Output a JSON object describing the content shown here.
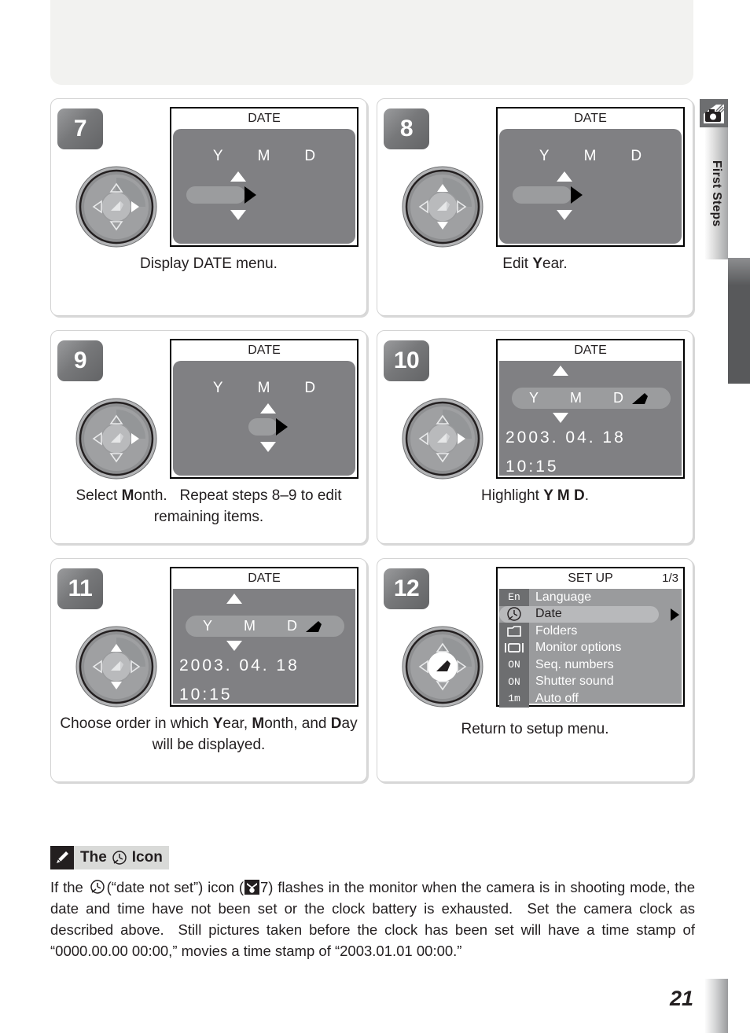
{
  "sidebar": {
    "icon_name": "hand-camera-icon",
    "tab_label": "First Steps"
  },
  "page_number": "21",
  "steps": [
    {
      "number": "7",
      "caption_html": "Display DATE menu.",
      "dial": {
        "highlight": "right"
      },
      "screen": {
        "kind": "ymd-slider",
        "title": "DATE",
        "labels": [
          "Y",
          "M",
          "D"
        ],
        "slider_column": "Y"
      }
    },
    {
      "number": "8",
      "caption_html": "Edit <b>Y</b>ear.",
      "dial": {
        "highlight": "up-down"
      },
      "screen": {
        "kind": "ymd-slider",
        "title": "DATE",
        "labels": [
          "Y",
          "M",
          "D"
        ],
        "slider_column": "Y"
      }
    },
    {
      "number": "9",
      "caption_html": "Select <b>M</b>onth.&nbsp;&nbsp; Repeat steps 8&#8211;9 to edit remaining items.",
      "dial": {
        "highlight": "right"
      },
      "screen": {
        "kind": "ymd-slider",
        "title": "DATE",
        "labels": [
          "Y",
          "M",
          "D"
        ],
        "slider_column": "M"
      }
    },
    {
      "number": "10",
      "caption_html": "Highlight <b>Y M D</b>.",
      "dial": {
        "highlight": "right"
      },
      "screen": {
        "kind": "ymd-bar",
        "title": "DATE",
        "labels": [
          "Y",
          "M",
          "D"
        ],
        "date_value": "2003. 04. 18",
        "time_value": "10:15",
        "enter_glyph": "enter-arrow-icon"
      }
    },
    {
      "number": "11",
      "caption_html": "Choose order in which <b>Y</b>ear, <b>M</b>onth, and <b>D</b>ay will be displayed.",
      "dial": {
        "highlight": "up-down"
      },
      "screen": {
        "kind": "ymd-bar",
        "title": "DATE",
        "labels": [
          "Y",
          "M",
          "D"
        ],
        "date_value": "2003. 04. 18",
        "time_value": "10:15",
        "enter_glyph": "enter-arrow-icon"
      }
    },
    {
      "number": "12",
      "caption_html": "Return to setup menu.",
      "dial": {
        "highlight": "center"
      },
      "screen": {
        "kind": "setup-menu",
        "title": "SET UP",
        "page_indicator": "1/3",
        "rows": [
          {
            "icon_text": "En",
            "icon_name": "language-icon",
            "label": "Language",
            "selected": false
          },
          {
            "icon_text": "",
            "icon_name": "clock-icon",
            "label": "Date",
            "selected": true
          },
          {
            "icon_text": "",
            "icon_name": "folder-icon",
            "label": "Folders",
            "selected": false
          },
          {
            "icon_text": "",
            "icon_name": "monitor-icon",
            "label": "Monitor options",
            "selected": false
          },
          {
            "icon_text": "ON",
            "icon_name": "on-icon",
            "label": "Seq. numbers",
            "selected": false
          },
          {
            "icon_text": "ON",
            "icon_name": "on-icon",
            "label": "Shutter sound",
            "selected": false
          },
          {
            "icon_text": "1m",
            "icon_name": "minute-icon",
            "label": "Auto off",
            "selected": false
          }
        ]
      }
    }
  ],
  "note": {
    "pencil_icon": "pencil-icon",
    "title_pre": "The",
    "title_icon": "clock-icon",
    "title_post": "Icon",
    "body_part1": "If the",
    "body_part2": "(“date not set”) icon (",
    "body_ref_page": "7) flashes in the monitor when the camera is in shooting mode, the date and time have not been set or the clock battery is exhausted.  Set the camera clock as described above.  Still pictures taken before the clock has been set will have a time stamp of “0000.00.00 00:00,” movies a time stamp of “2003.01.01 00:00.”"
  },
  "colors": {
    "lcd_background": "#808083",
    "lcd_pill": "#9b9c9e",
    "badge_gray": "#77787a",
    "panel_border": "#d3d3d3",
    "note_title_bg": "#d9dad8",
    "setup_menu_bg": "#9a9b9d",
    "setup_icon_col": "#6d6e70"
  }
}
